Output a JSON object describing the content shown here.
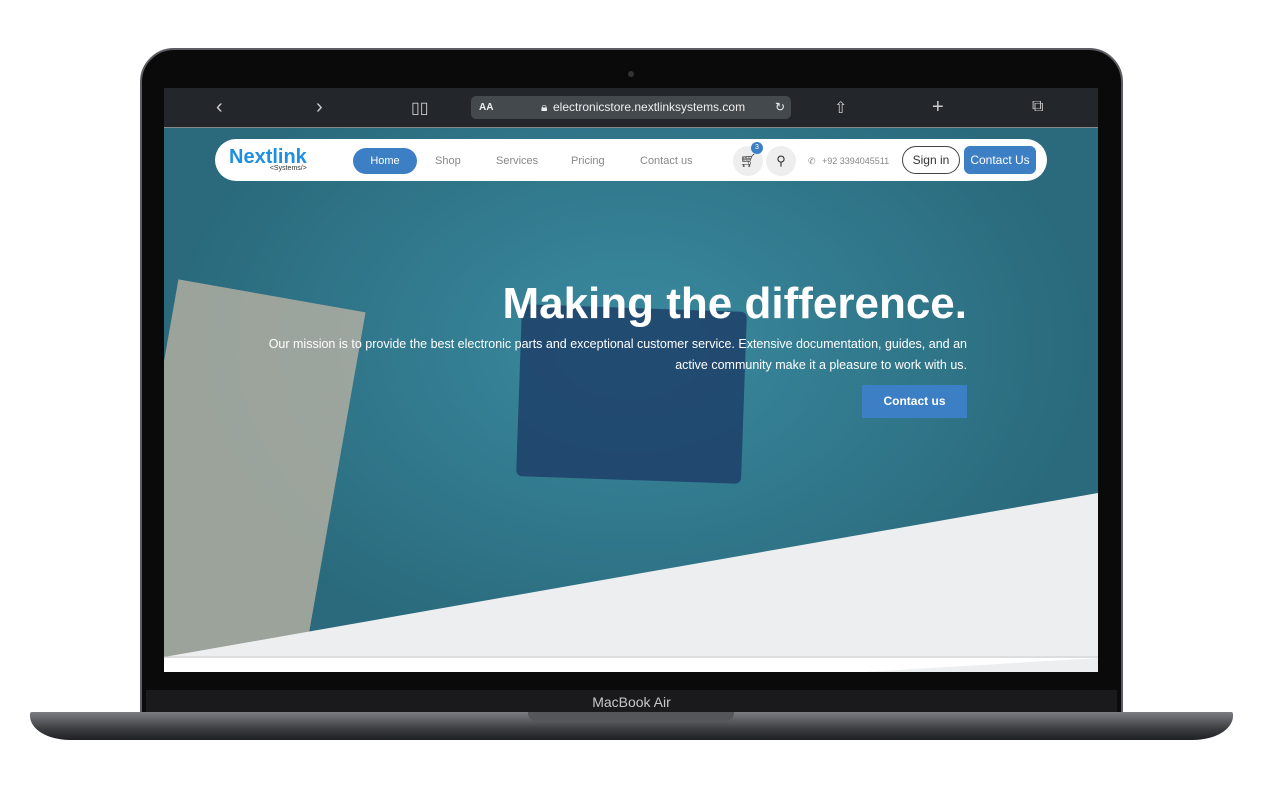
{
  "device": {
    "label": "MacBook Air"
  },
  "browser": {
    "url": "electronicstore.nextlinksystems.com",
    "text_size": "AA"
  },
  "nav": {
    "logo": "Nextlink",
    "logo_sub": "<Systems/>",
    "items": [
      "Home",
      "Shop",
      "Services",
      "Pricing",
      "Contact us"
    ],
    "cart_count": "3",
    "phone": "+92 3394045511",
    "signin": "Sign in",
    "contact": "Contact Us"
  },
  "hero": {
    "title": "Making the difference.",
    "text": "Our mission is to provide the best electronic parts and exceptional customer service. Extensive documentation, guides, and an active community make it a pleasure to work with us.",
    "button": "Contact us"
  },
  "colors": {
    "accent": "#3c7fc4",
    "hero": "#2f6f80"
  }
}
